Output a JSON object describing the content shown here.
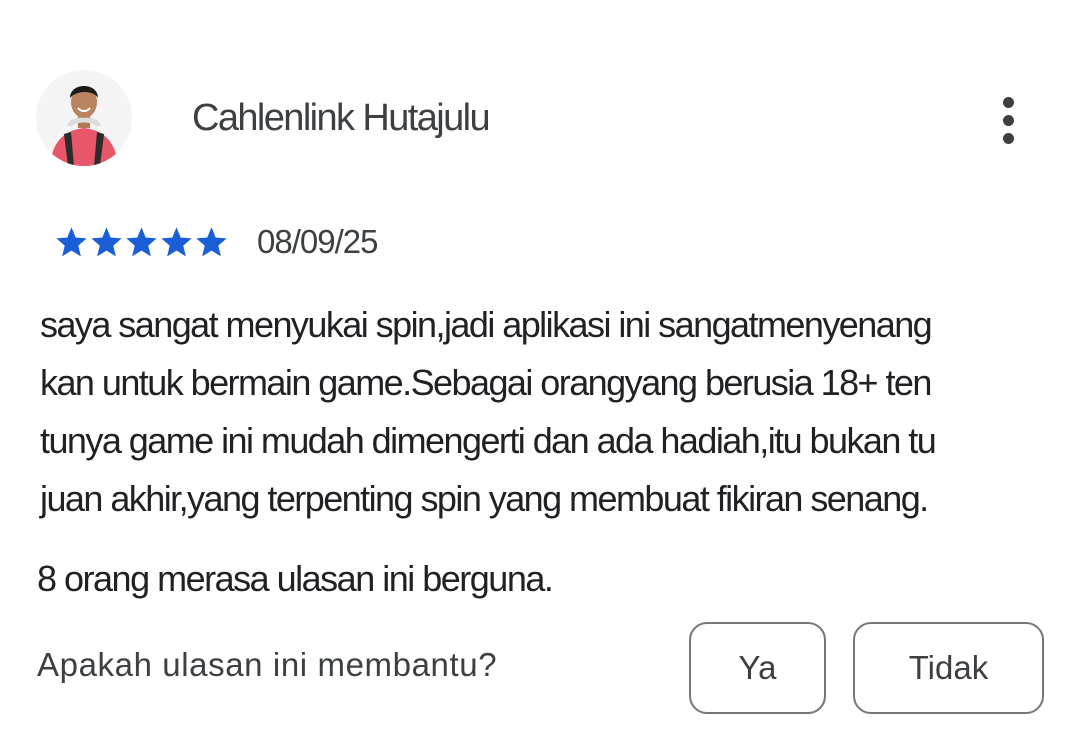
{
  "review": {
    "reviewer_name": "Cahlenlink Hutajulu",
    "avatar_icon": "user-photo-avatar",
    "more_icon": "more-vertical-icon",
    "rating": 5,
    "rating_max": 5,
    "star_color": "#1a5fd8",
    "star_icon": "star-icon",
    "date": "08/09/25",
    "text_lines": [
      "saya sangat menyukai spin,jadi aplikasi ini sangatmenyenang",
      "kan untuk bermain game.Sebagai orangyang berusia 18+ ten",
      "tunya game ini mudah dimengerti dan ada hadiah,itu bukan tu",
      "juan akhir,yang terpenting spin yang membuat fikiran senang."
    ]
  },
  "helpful": {
    "count_text": "8 orang merasa ulasan ini berguna.",
    "prompt": "Apakah ulasan ini membantu?",
    "yes_label": "Ya",
    "no_label": "Tidak"
  }
}
